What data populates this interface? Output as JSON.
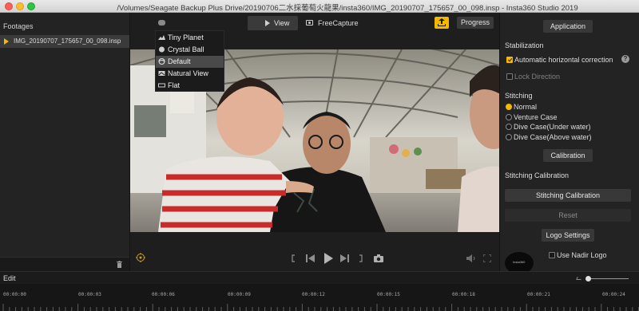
{
  "window": {
    "title": "/Volumes/Seagate Backup Plus Drive/20190706二水採葡萄火龍果/insta360/IMG_20190707_175657_00_098.insp - Insta360 Studio 2019"
  },
  "left_panel": {
    "header": "Footages",
    "items": [
      {
        "label": "IMG_20190707_175657_00_098.insp",
        "selected": true
      }
    ],
    "icons": [
      "play-indicator-icon",
      "trash-icon"
    ]
  },
  "toolbar": {
    "view_label": "View",
    "freecapture_label": "FreeCapture",
    "progress_label": "Progress",
    "share_icon": "export-icon",
    "accent": "#f5b800"
  },
  "view_menu": {
    "items": [
      {
        "label": "Tiny Planet",
        "icon": "tiny-planet-icon",
        "selected": false
      },
      {
        "label": "Crystal Ball",
        "icon": "crystal-ball-icon",
        "selected": false
      },
      {
        "label": "Default",
        "icon": "default-view-icon",
        "selected": true
      },
      {
        "label": "Natural View",
        "icon": "natural-view-icon",
        "selected": false
      },
      {
        "label": "Flat",
        "icon": "flat-view-icon",
        "selected": false
      }
    ]
  },
  "playback": {
    "icons": [
      "target-icon",
      "bracket-left-icon",
      "prev-frame-icon",
      "play-icon",
      "next-frame-icon",
      "bracket-right-icon",
      "camera-icon",
      "volume-icon",
      "fullscreen-icon"
    ]
  },
  "right_panel": {
    "application_btn": "Application",
    "stabilization_header": "Stabilization",
    "auto_horizontal_label": "Automatic horizontal correction",
    "auto_horizontal_checked": true,
    "lock_direction_label": "Lock Direction",
    "lock_direction_checked": false,
    "stitching_header": "Stitching",
    "stitching_options": [
      {
        "label": "Normal",
        "selected": true
      },
      {
        "label": "Venture Case",
        "selected": false
      },
      {
        "label": "Dive Case(Under water)",
        "selected": false
      },
      {
        "label": "Dive Case(Above water)",
        "selected": false
      }
    ],
    "calibration_btn": "Calibration",
    "stitching_calibration_header": "Stitching Calibration",
    "stitching_calibration_btn": "Stitching Calibration",
    "reset_btn": "Reset",
    "logo_settings_btn": "Logo Settings",
    "use_nadir_logo_label": "Use Nadir Logo",
    "use_nadir_logo_checked": false,
    "logo_text": "Insta360"
  },
  "edit": {
    "label": "Edit",
    "zoom_level": 0.0,
    "timeline_labels": [
      "00:00:00",
      "00:00:03",
      "00:00:06",
      "00:00:09",
      "00:00:12",
      "00:00:15",
      "00:00:18",
      "00:00:21",
      "00:00:24"
    ]
  }
}
